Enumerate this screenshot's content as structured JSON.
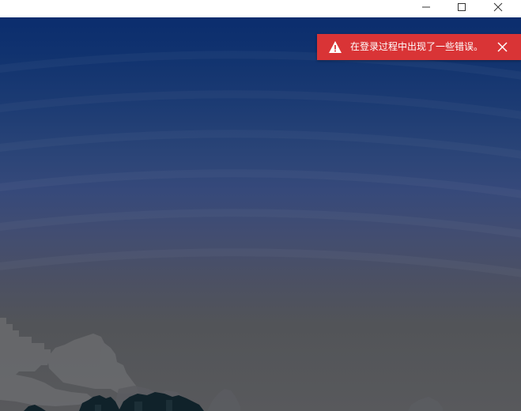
{
  "window": {
    "controls": {
      "minimize_icon": "minimize-icon",
      "maximize_icon": "maximize-icon",
      "close_icon": "close-icon"
    }
  },
  "notification": {
    "type": "error",
    "icon": "warning-icon",
    "message": "在登录过程中出现了一些错误。",
    "dismiss_icon": "close-icon",
    "background_color": "#d93436",
    "text_color": "#ffffff"
  },
  "background": {
    "sky_top_color": "#0b2d6e",
    "sky_bottom_color": "#58595c"
  }
}
